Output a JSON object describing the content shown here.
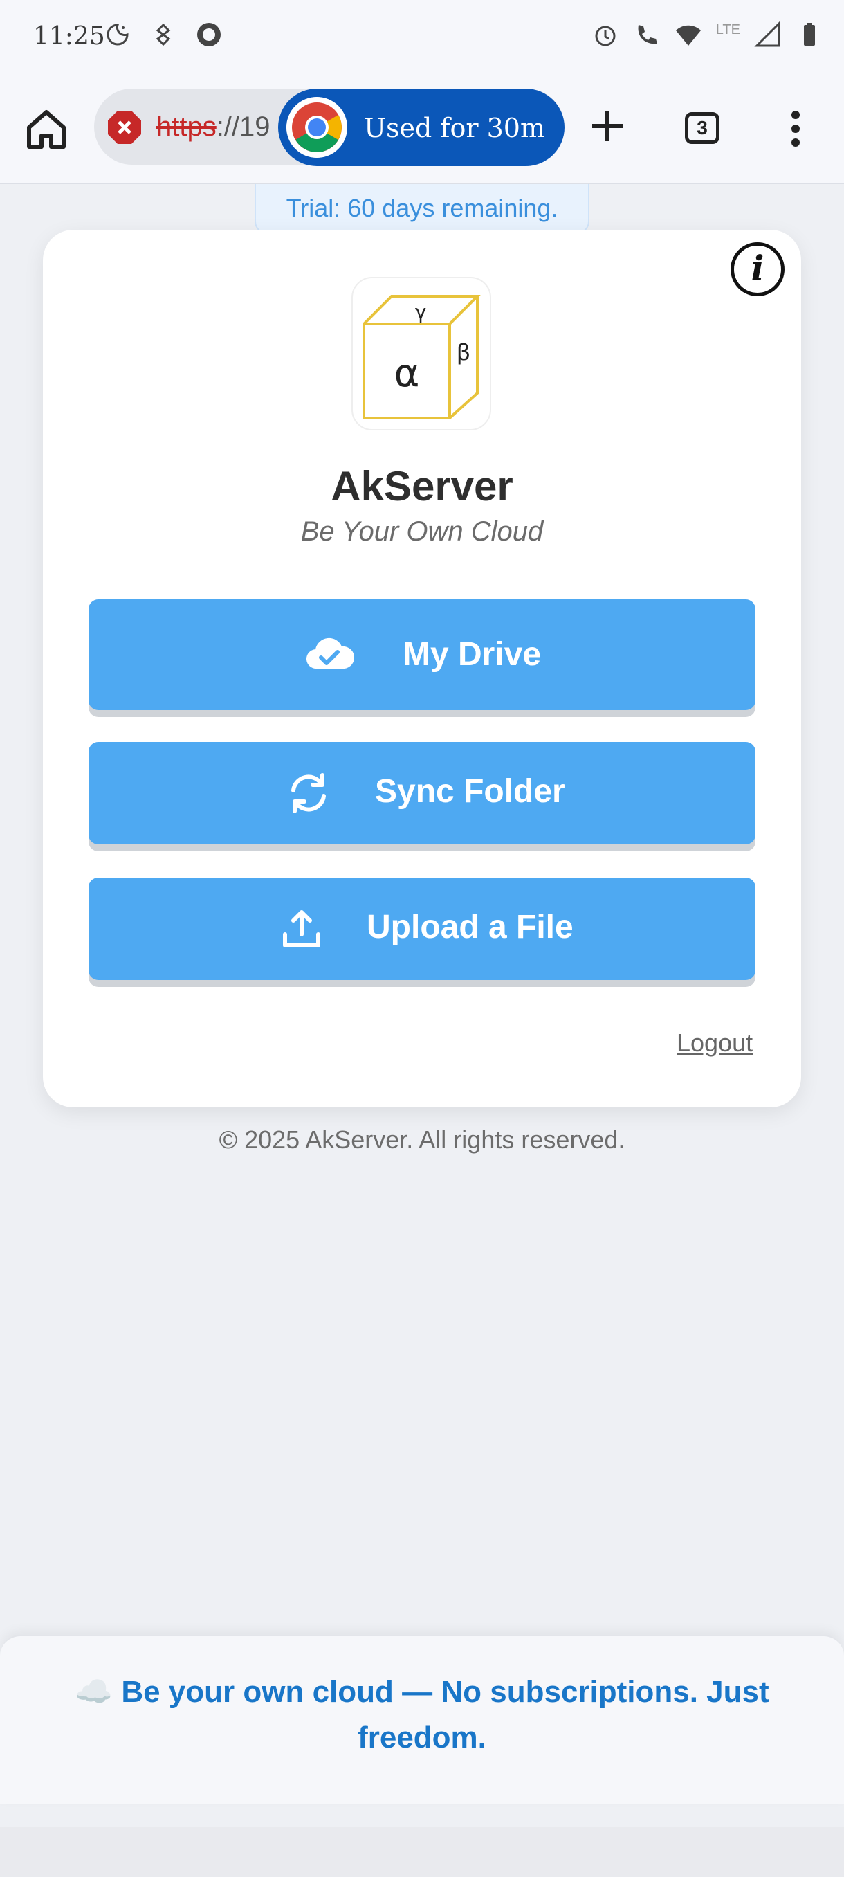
{
  "status_bar": {
    "time": "11:25",
    "left_icons": [
      "moon-clock-icon",
      "sync-app-icon",
      "ghost-app-icon"
    ],
    "right_icons": [
      "alarm-icon",
      "wifi-call-icon",
      "wifi-icon",
      "lte-signal-icon",
      "battery-icon"
    ],
    "network": "LTE"
  },
  "browser": {
    "url_scheme": "https",
    "url_rest": "://19",
    "chip_label": "Used for 30m",
    "tab_count": "3"
  },
  "trial_banner": "Trial: 60 days remaining.",
  "card": {
    "info_glyph": "i",
    "logo_letters": {
      "front": "α",
      "side": "β",
      "top": "γ"
    },
    "title": "AkServer",
    "tagline": "Be Your Own Cloud",
    "buttons": [
      {
        "label": "My Drive",
        "icon": "cloud-check-icon"
      },
      {
        "label": "Sync Folder",
        "icon": "sync-icon"
      },
      {
        "label": "Upload a File",
        "icon": "upload-icon"
      }
    ],
    "logout": "Logout"
  },
  "footer": "© 2025 AkServer. All rights reserved.",
  "promo": "☁️ Be your own cloud — No subscriptions. Just freedom.",
  "colors": {
    "primary_button": "#4ea9f2",
    "chip": "#0b57b8",
    "promo_text": "#1976c8",
    "logo_stroke": "#e8c33b"
  }
}
